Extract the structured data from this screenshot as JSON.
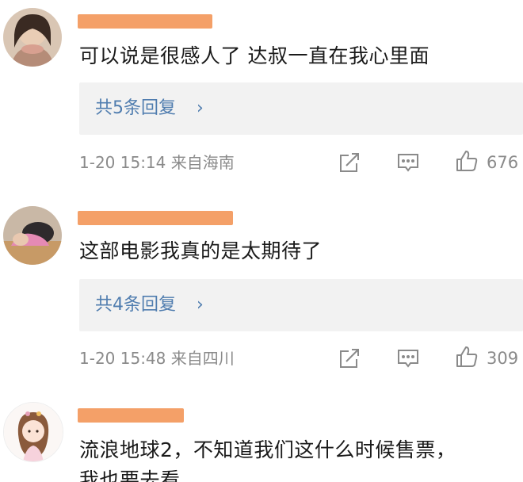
{
  "comments": [
    {
      "text": "可以说是很感人了 达叔一直在我心里面",
      "reply_label": "共5条回复",
      "reply_arrow": "›",
      "meta": "1-20 15:14 来自海南",
      "likes": "676"
    },
    {
      "text": "这部电影我真的是太期待了",
      "reply_label": "共4条回复",
      "reply_arrow": "›",
      "meta": "1-20 15:48 来自四川",
      "likes": "309"
    },
    {
      "text_line1": "流浪地球2，不知道我们这什么时候售票，",
      "text_line2": "我也要去看"
    }
  ],
  "icons": {
    "share": "share-icon",
    "comment": "comment-icon",
    "like": "thumbs-up-icon"
  },
  "colors": {
    "link": "#507daf",
    "meta": "#8a8a8a",
    "reply_bg": "#f2f2f2",
    "redaction": "#f4a068"
  }
}
